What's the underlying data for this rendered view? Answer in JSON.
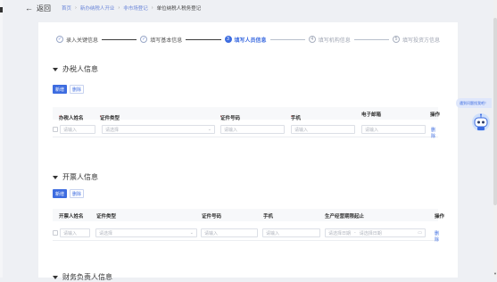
{
  "header": {
    "back_label": "返回",
    "breadcrumb": [
      "首页",
      "新办纳税人开业",
      "非市场登记",
      "单位纳税人税务登记"
    ]
  },
  "steps": [
    {
      "label": "录入关键信息",
      "state": "done",
      "mark": "✓"
    },
    {
      "label": "填写基本信息",
      "state": "done",
      "mark": "✓"
    },
    {
      "label": "填写人员信息",
      "state": "active",
      "mark": "3"
    },
    {
      "label": "填写机构信息",
      "state": "todo",
      "mark": "4"
    },
    {
      "label": "填写投资方信息",
      "state": "todo",
      "mark": "5"
    }
  ],
  "section1": {
    "title": "办税人信息",
    "add_label": "新增",
    "delete_label": "删除",
    "columns": [
      "办税人姓名",
      "证件类型",
      "证件号码",
      "手机",
      "电子邮箱",
      "操作"
    ],
    "row": {
      "name_placeholder": "请输入",
      "type_placeholder": "请选择",
      "id_placeholder": "请输入",
      "phone_placeholder": "请输入",
      "email_placeholder": "请输入",
      "action_label": "删除"
    }
  },
  "section2": {
    "title": "开票人信息",
    "add_label": "新增",
    "delete_label": "删除",
    "columns": [
      "开票人姓名",
      "证件类型",
      "证件号码",
      "手机",
      "生产经营期限起止",
      "操作"
    ],
    "row": {
      "name_placeholder": "请输入",
      "type_placeholder": "请选择",
      "id_placeholder": "请输入",
      "phone_placeholder": "请输入",
      "start_placeholder": "请选择日期",
      "end_placeholder": "请选择日期",
      "dash": "-",
      "action_label": "删除"
    }
  },
  "section3": {
    "title": "财务负责人信息"
  },
  "float_hint": "遇到问题找我吧！",
  "colors": {
    "accent": "#3d6ce0",
    "required": "#e04b4b",
    "page_bg": "#eef0f4"
  }
}
